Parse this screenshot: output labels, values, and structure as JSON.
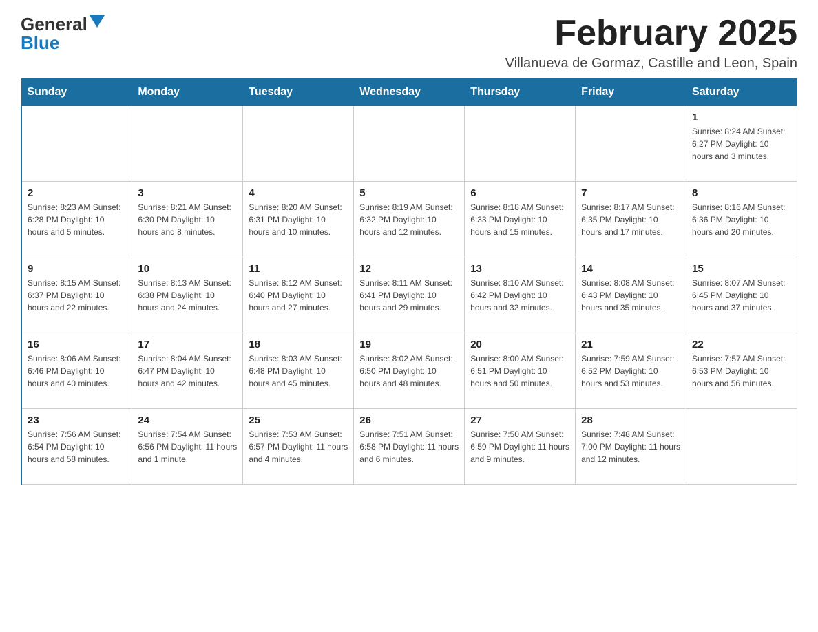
{
  "header": {
    "logo_line1": "General",
    "logo_line2": "Blue",
    "main_title": "February 2025",
    "subtitle": "Villanueva de Gormaz, Castille and Leon, Spain"
  },
  "days_of_week": [
    "Sunday",
    "Monday",
    "Tuesday",
    "Wednesday",
    "Thursday",
    "Friday",
    "Saturday"
  ],
  "weeks": [
    [
      {
        "day": "",
        "info": ""
      },
      {
        "day": "",
        "info": ""
      },
      {
        "day": "",
        "info": ""
      },
      {
        "day": "",
        "info": ""
      },
      {
        "day": "",
        "info": ""
      },
      {
        "day": "",
        "info": ""
      },
      {
        "day": "1",
        "info": "Sunrise: 8:24 AM\nSunset: 6:27 PM\nDaylight: 10 hours and 3 minutes."
      }
    ],
    [
      {
        "day": "2",
        "info": "Sunrise: 8:23 AM\nSunset: 6:28 PM\nDaylight: 10 hours and 5 minutes."
      },
      {
        "day": "3",
        "info": "Sunrise: 8:21 AM\nSunset: 6:30 PM\nDaylight: 10 hours and 8 minutes."
      },
      {
        "day": "4",
        "info": "Sunrise: 8:20 AM\nSunset: 6:31 PM\nDaylight: 10 hours and 10 minutes."
      },
      {
        "day": "5",
        "info": "Sunrise: 8:19 AM\nSunset: 6:32 PM\nDaylight: 10 hours and 12 minutes."
      },
      {
        "day": "6",
        "info": "Sunrise: 8:18 AM\nSunset: 6:33 PM\nDaylight: 10 hours and 15 minutes."
      },
      {
        "day": "7",
        "info": "Sunrise: 8:17 AM\nSunset: 6:35 PM\nDaylight: 10 hours and 17 minutes."
      },
      {
        "day": "8",
        "info": "Sunrise: 8:16 AM\nSunset: 6:36 PM\nDaylight: 10 hours and 20 minutes."
      }
    ],
    [
      {
        "day": "9",
        "info": "Sunrise: 8:15 AM\nSunset: 6:37 PM\nDaylight: 10 hours and 22 minutes."
      },
      {
        "day": "10",
        "info": "Sunrise: 8:13 AM\nSunset: 6:38 PM\nDaylight: 10 hours and 24 minutes."
      },
      {
        "day": "11",
        "info": "Sunrise: 8:12 AM\nSunset: 6:40 PM\nDaylight: 10 hours and 27 minutes."
      },
      {
        "day": "12",
        "info": "Sunrise: 8:11 AM\nSunset: 6:41 PM\nDaylight: 10 hours and 29 minutes."
      },
      {
        "day": "13",
        "info": "Sunrise: 8:10 AM\nSunset: 6:42 PM\nDaylight: 10 hours and 32 minutes."
      },
      {
        "day": "14",
        "info": "Sunrise: 8:08 AM\nSunset: 6:43 PM\nDaylight: 10 hours and 35 minutes."
      },
      {
        "day": "15",
        "info": "Sunrise: 8:07 AM\nSunset: 6:45 PM\nDaylight: 10 hours and 37 minutes."
      }
    ],
    [
      {
        "day": "16",
        "info": "Sunrise: 8:06 AM\nSunset: 6:46 PM\nDaylight: 10 hours and 40 minutes."
      },
      {
        "day": "17",
        "info": "Sunrise: 8:04 AM\nSunset: 6:47 PM\nDaylight: 10 hours and 42 minutes."
      },
      {
        "day": "18",
        "info": "Sunrise: 8:03 AM\nSunset: 6:48 PM\nDaylight: 10 hours and 45 minutes."
      },
      {
        "day": "19",
        "info": "Sunrise: 8:02 AM\nSunset: 6:50 PM\nDaylight: 10 hours and 48 minutes."
      },
      {
        "day": "20",
        "info": "Sunrise: 8:00 AM\nSunset: 6:51 PM\nDaylight: 10 hours and 50 minutes."
      },
      {
        "day": "21",
        "info": "Sunrise: 7:59 AM\nSunset: 6:52 PM\nDaylight: 10 hours and 53 minutes."
      },
      {
        "day": "22",
        "info": "Sunrise: 7:57 AM\nSunset: 6:53 PM\nDaylight: 10 hours and 56 minutes."
      }
    ],
    [
      {
        "day": "23",
        "info": "Sunrise: 7:56 AM\nSunset: 6:54 PM\nDaylight: 10 hours and 58 minutes."
      },
      {
        "day": "24",
        "info": "Sunrise: 7:54 AM\nSunset: 6:56 PM\nDaylight: 11 hours and 1 minute."
      },
      {
        "day": "25",
        "info": "Sunrise: 7:53 AM\nSunset: 6:57 PM\nDaylight: 11 hours and 4 minutes."
      },
      {
        "day": "26",
        "info": "Sunrise: 7:51 AM\nSunset: 6:58 PM\nDaylight: 11 hours and 6 minutes."
      },
      {
        "day": "27",
        "info": "Sunrise: 7:50 AM\nSunset: 6:59 PM\nDaylight: 11 hours and 9 minutes."
      },
      {
        "day": "28",
        "info": "Sunrise: 7:48 AM\nSunset: 7:00 PM\nDaylight: 11 hours and 12 minutes."
      },
      {
        "day": "",
        "info": ""
      }
    ]
  ]
}
